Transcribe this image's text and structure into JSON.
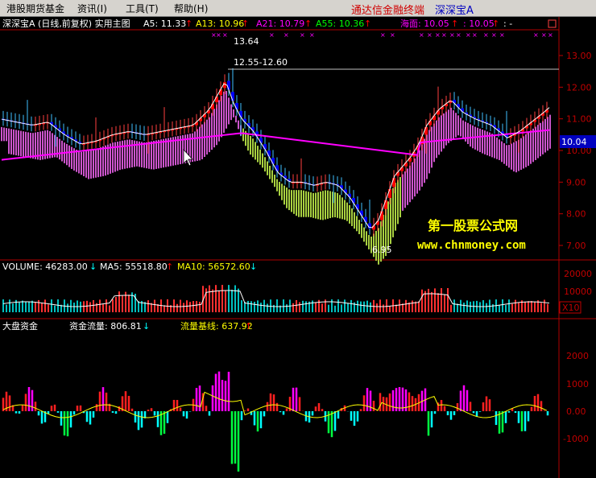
{
  "menu": {
    "items": [
      "港股期货基金",
      "资讯(I)",
      "工具(T)",
      "帮助(H)"
    ],
    "app_title": "通达信金融终端",
    "stock_name": "深深宝A"
  },
  "main_panel": {
    "title": "深深宝A (日线,前复权) 实用主图",
    "indicators": [
      {
        "label": "A5: 11.33",
        "color": "#ffffff"
      },
      {
        "label": "A13: 10.96",
        "color": "#ffff00"
      },
      {
        "label": "A21: 10.79",
        "color": "#ff00ff"
      },
      {
        "label": "A55: 10.36",
        "color": "#00ff00"
      },
      {
        "label": "海面: 10.05",
        "color": "#ff00ff"
      },
      {
        "label": ": 10.05",
        "color": "#ff00ff"
      },
      {
        "label": ": -",
        "color": "#ffffff"
      }
    ],
    "price_axis": [
      "13.00",
      "12.00",
      "11.00",
      "10.00",
      "9.00",
      "8.00",
      "7.00"
    ],
    "current_price": "10.04",
    "high_label": "13.64",
    "range_label": "12.55-12.60",
    "low_label": "6.95",
    "watermark_title": "第一股票公式网",
    "watermark_url": "www.chnmoney.com",
    "up_arrow": "↑",
    "down_arrow": "↓"
  },
  "volume_panel": {
    "indicators": [
      {
        "label": "VOLUME: 46283.00",
        "color": "#ffffff",
        "arrow": "↓"
      },
      {
        "label": "MA5: 55518.80",
        "color": "#ffffff",
        "arrow": "↑"
      },
      {
        "label": "MA10: 56572.60",
        "color": "#ffff00",
        "arrow": "↓"
      }
    ],
    "axis": [
      "20000",
      "10000"
    ],
    "multiplier": "X10"
  },
  "flow_panel": {
    "title": "大盘资金",
    "indicators": [
      {
        "label": "资金流量: 806.81",
        "color": "#ffffff",
        "arrow": "↓"
      },
      {
        "label": "流量基线: 637.92",
        "color": "#ffff00",
        "arrow": "↑"
      }
    ],
    "axis": [
      "2000",
      "1000",
      "0.00",
      "-1000"
    ]
  },
  "colors": {
    "up": "#ff0000",
    "down": "#0000ff",
    "ribbon_up": "#cc55cc",
    "ribbon_down": "#a8d040",
    "border": "#b00000",
    "axis_text": "#c00000"
  }
}
